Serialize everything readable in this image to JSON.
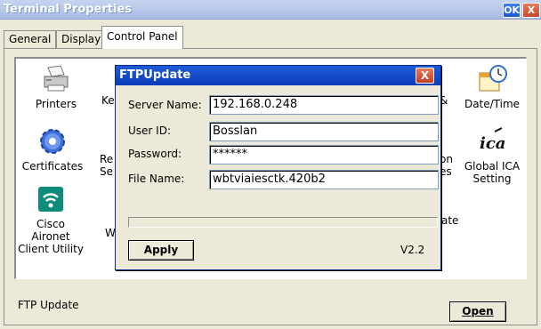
{
  "window": {
    "title": "Terminal Properties",
    "ok_label": "OK",
    "close_label": "X"
  },
  "tabs": [
    {
      "label": "General"
    },
    {
      "label": "Display"
    },
    {
      "label": "Control Panel"
    }
  ],
  "control_panel": {
    "items": [
      {
        "label": "Printers",
        "icon": "printer-icon"
      },
      {
        "label": "Certificates",
        "icon": "certificate-gear-icon"
      },
      {
        "label": "Cisco Aironet Client Utility",
        "icon": "wifi-icon"
      },
      {
        "label": "Date/Time",
        "icon": "calendar-clock-icon"
      },
      {
        "label": "Global ICA Setting",
        "icon": "ica-icon"
      }
    ],
    "partial_labels": [
      "Ke",
      "Re",
      "Se",
      "W",
      "&",
      "on",
      "es",
      "ate"
    ]
  },
  "status_text": "FTP Update",
  "open_button": {
    "label": "Open"
  },
  "dialog": {
    "title": "FTPUpdate",
    "close_label": "X",
    "fields": [
      {
        "label": "Server Name:",
        "value": "192.168.0.248"
      },
      {
        "label": "User ID:",
        "value": "Bosslan"
      },
      {
        "label": "Password:",
        "value": "******"
      },
      {
        "label": "File Name:",
        "value": "wbtviaiesctk.420b2"
      }
    ],
    "progress": 0,
    "apply_label": "Apply",
    "version": "V2.2"
  },
  "colors": {
    "title_bar": "#a9bde6",
    "dialog_title": "#0a3dba",
    "accent": "#2c61d6"
  }
}
